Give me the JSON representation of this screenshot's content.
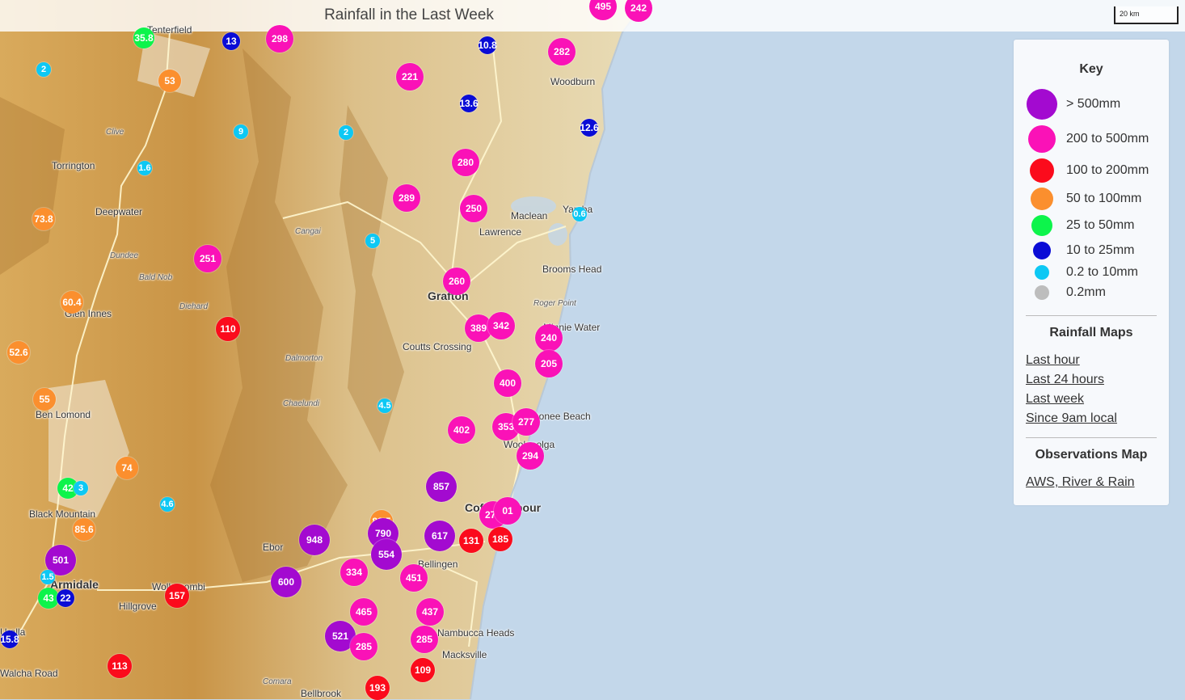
{
  "title": "Rainfall in the Last Week",
  "scale_label": "20 km",
  "legend": {
    "title": "Key",
    "items": [
      {
        "label": "> 500mm",
        "color": "#a30ad0"
      },
      {
        "label": "200 to 500mm",
        "color": "#fa12b7"
      },
      {
        "label": "100 to 200mm",
        "color": "#fb0b1c"
      },
      {
        "label": "50 to 100mm",
        "color": "#fb8f2e"
      },
      {
        "label": "25 to 50mm",
        "color": "#0df44b"
      },
      {
        "label": "10 to 25mm",
        "color": "#0a0cd6"
      },
      {
        "label": "0.2 to 10mm",
        "color": "#0dc8f4"
      },
      {
        "label": "0.2mm",
        "color": "#bdbdbd"
      }
    ],
    "rainfall_maps_title": "Rainfall Maps",
    "links": [
      "Last hour",
      "Last 24 hours",
      "Last week",
      "Since 9am local"
    ],
    "observations_title": "Observations Map",
    "observations_link": "AWS, River & Rain"
  },
  "places": [
    {
      "name": "Tenterfield"
    },
    {
      "name": "Clive"
    },
    {
      "name": "Torrington"
    },
    {
      "name": "Deepwater"
    },
    {
      "name": "Dundee"
    },
    {
      "name": "Bald Nob"
    },
    {
      "name": "Glen Innes"
    },
    {
      "name": "Diehard"
    },
    {
      "name": "Cangai"
    },
    {
      "name": "Dalmorton"
    },
    {
      "name": "Chaelundi"
    },
    {
      "name": "Ben Lomond"
    },
    {
      "name": "Black Mountain"
    },
    {
      "name": "Armidale"
    },
    {
      "name": "Hillgrove"
    },
    {
      "name": "Wollomombi"
    },
    {
      "name": "Ebor"
    },
    {
      "name": "Bellingen"
    },
    {
      "name": "Nambucca Heads"
    },
    {
      "name": "Macksville"
    },
    {
      "name": "Coffs Harbour"
    },
    {
      "name": "Woolgoolga"
    },
    {
      "name": "Moonee Beach"
    },
    {
      "name": "Coutts Crossing"
    },
    {
      "name": "Grafton"
    },
    {
      "name": "Lawrence"
    },
    {
      "name": "Maclean"
    },
    {
      "name": "Yamba"
    },
    {
      "name": "Brooms Head"
    },
    {
      "name": "Roger Point"
    },
    {
      "name": "Minnie Water"
    },
    {
      "name": "Woodburn"
    },
    {
      "name": "Comara"
    },
    {
      "name": "Uralla"
    },
    {
      "name": "Walcha Road"
    },
    {
      "name": "Bellbrook"
    }
  ],
  "markers": [
    {
      "value": "35.8",
      "cat": 4
    },
    {
      "value": "13",
      "cat": 5
    },
    {
      "value": "298",
      "cat": 1
    },
    {
      "value": "10.8",
      "cat": 5
    },
    {
      "value": "282",
      "cat": 1
    },
    {
      "value": "495",
      "cat": 1
    },
    {
      "value": "242",
      "cat": 1
    },
    {
      "value": "2",
      "cat": 6
    },
    {
      "value": "53",
      "cat": 3
    },
    {
      "value": "221",
      "cat": 1
    },
    {
      "value": "13.6",
      "cat": 5
    },
    {
      "value": "9",
      "cat": 6
    },
    {
      "value": "2",
      "cat": 6
    },
    {
      "value": "12.6",
      "cat": 5
    },
    {
      "value": "1.6",
      "cat": 6
    },
    {
      "value": "280",
      "cat": 1
    },
    {
      "value": "73.8",
      "cat": 3
    },
    {
      "value": "289",
      "cat": 1
    },
    {
      "value": "250",
      "cat": 1
    },
    {
      "value": "0.6",
      "cat": 6
    },
    {
      "value": "5",
      "cat": 6
    },
    {
      "value": "251",
      "cat": 1
    },
    {
      "value": "260",
      "cat": 1
    },
    {
      "value": "60.4",
      "cat": 3
    },
    {
      "value": "110",
      "cat": 2
    },
    {
      "value": "389",
      "cat": 1
    },
    {
      "value": "342",
      "cat": 1
    },
    {
      "value": "240",
      "cat": 1
    },
    {
      "value": "52.6",
      "cat": 3
    },
    {
      "value": "205",
      "cat": 1
    },
    {
      "value": "400",
      "cat": 1
    },
    {
      "value": "55",
      "cat": 3
    },
    {
      "value": "4.5",
      "cat": 6
    },
    {
      "value": "402",
      "cat": 1
    },
    {
      "value": "353",
      "cat": 1
    },
    {
      "value": "277",
      "cat": 1
    },
    {
      "value": "294",
      "cat": 1
    },
    {
      "value": "74",
      "cat": 3
    },
    {
      "value": "857",
      "cat": 0
    },
    {
      "value": "42",
      "cat": 4
    },
    {
      "value": "3",
      "cat": 6
    },
    {
      "value": "4.6",
      "cat": 6
    },
    {
      "value": "80.5",
      "cat": 3
    },
    {
      "value": "277",
      "cat": 1
    },
    {
      "value": "01",
      "cat": 1
    },
    {
      "value": "85.6",
      "cat": 3
    },
    {
      "value": "948",
      "cat": 0
    },
    {
      "value": "790",
      "cat": 0
    },
    {
      "value": "617",
      "cat": 0
    },
    {
      "value": "131",
      "cat": 2
    },
    {
      "value": "185",
      "cat": 2
    },
    {
      "value": "501",
      "cat": 0
    },
    {
      "value": "554",
      "cat": 0
    },
    {
      "value": "1.5",
      "cat": 6
    },
    {
      "value": "334",
      "cat": 1
    },
    {
      "value": "451",
      "cat": 1
    },
    {
      "value": "600",
      "cat": 0
    },
    {
      "value": "43",
      "cat": 4
    },
    {
      "value": "22",
      "cat": 5
    },
    {
      "value": "157",
      "cat": 2
    },
    {
      "value": "465",
      "cat": 1
    },
    {
      "value": "437",
      "cat": 1
    },
    {
      "value": "521",
      "cat": 0
    },
    {
      "value": "285",
      "cat": 1
    },
    {
      "value": "285",
      "cat": 1
    },
    {
      "value": "15.8",
      "cat": 5
    },
    {
      "value": "113",
      "cat": 2
    },
    {
      "value": "109",
      "cat": 2
    },
    {
      "value": "193",
      "cat": 2
    }
  ]
}
